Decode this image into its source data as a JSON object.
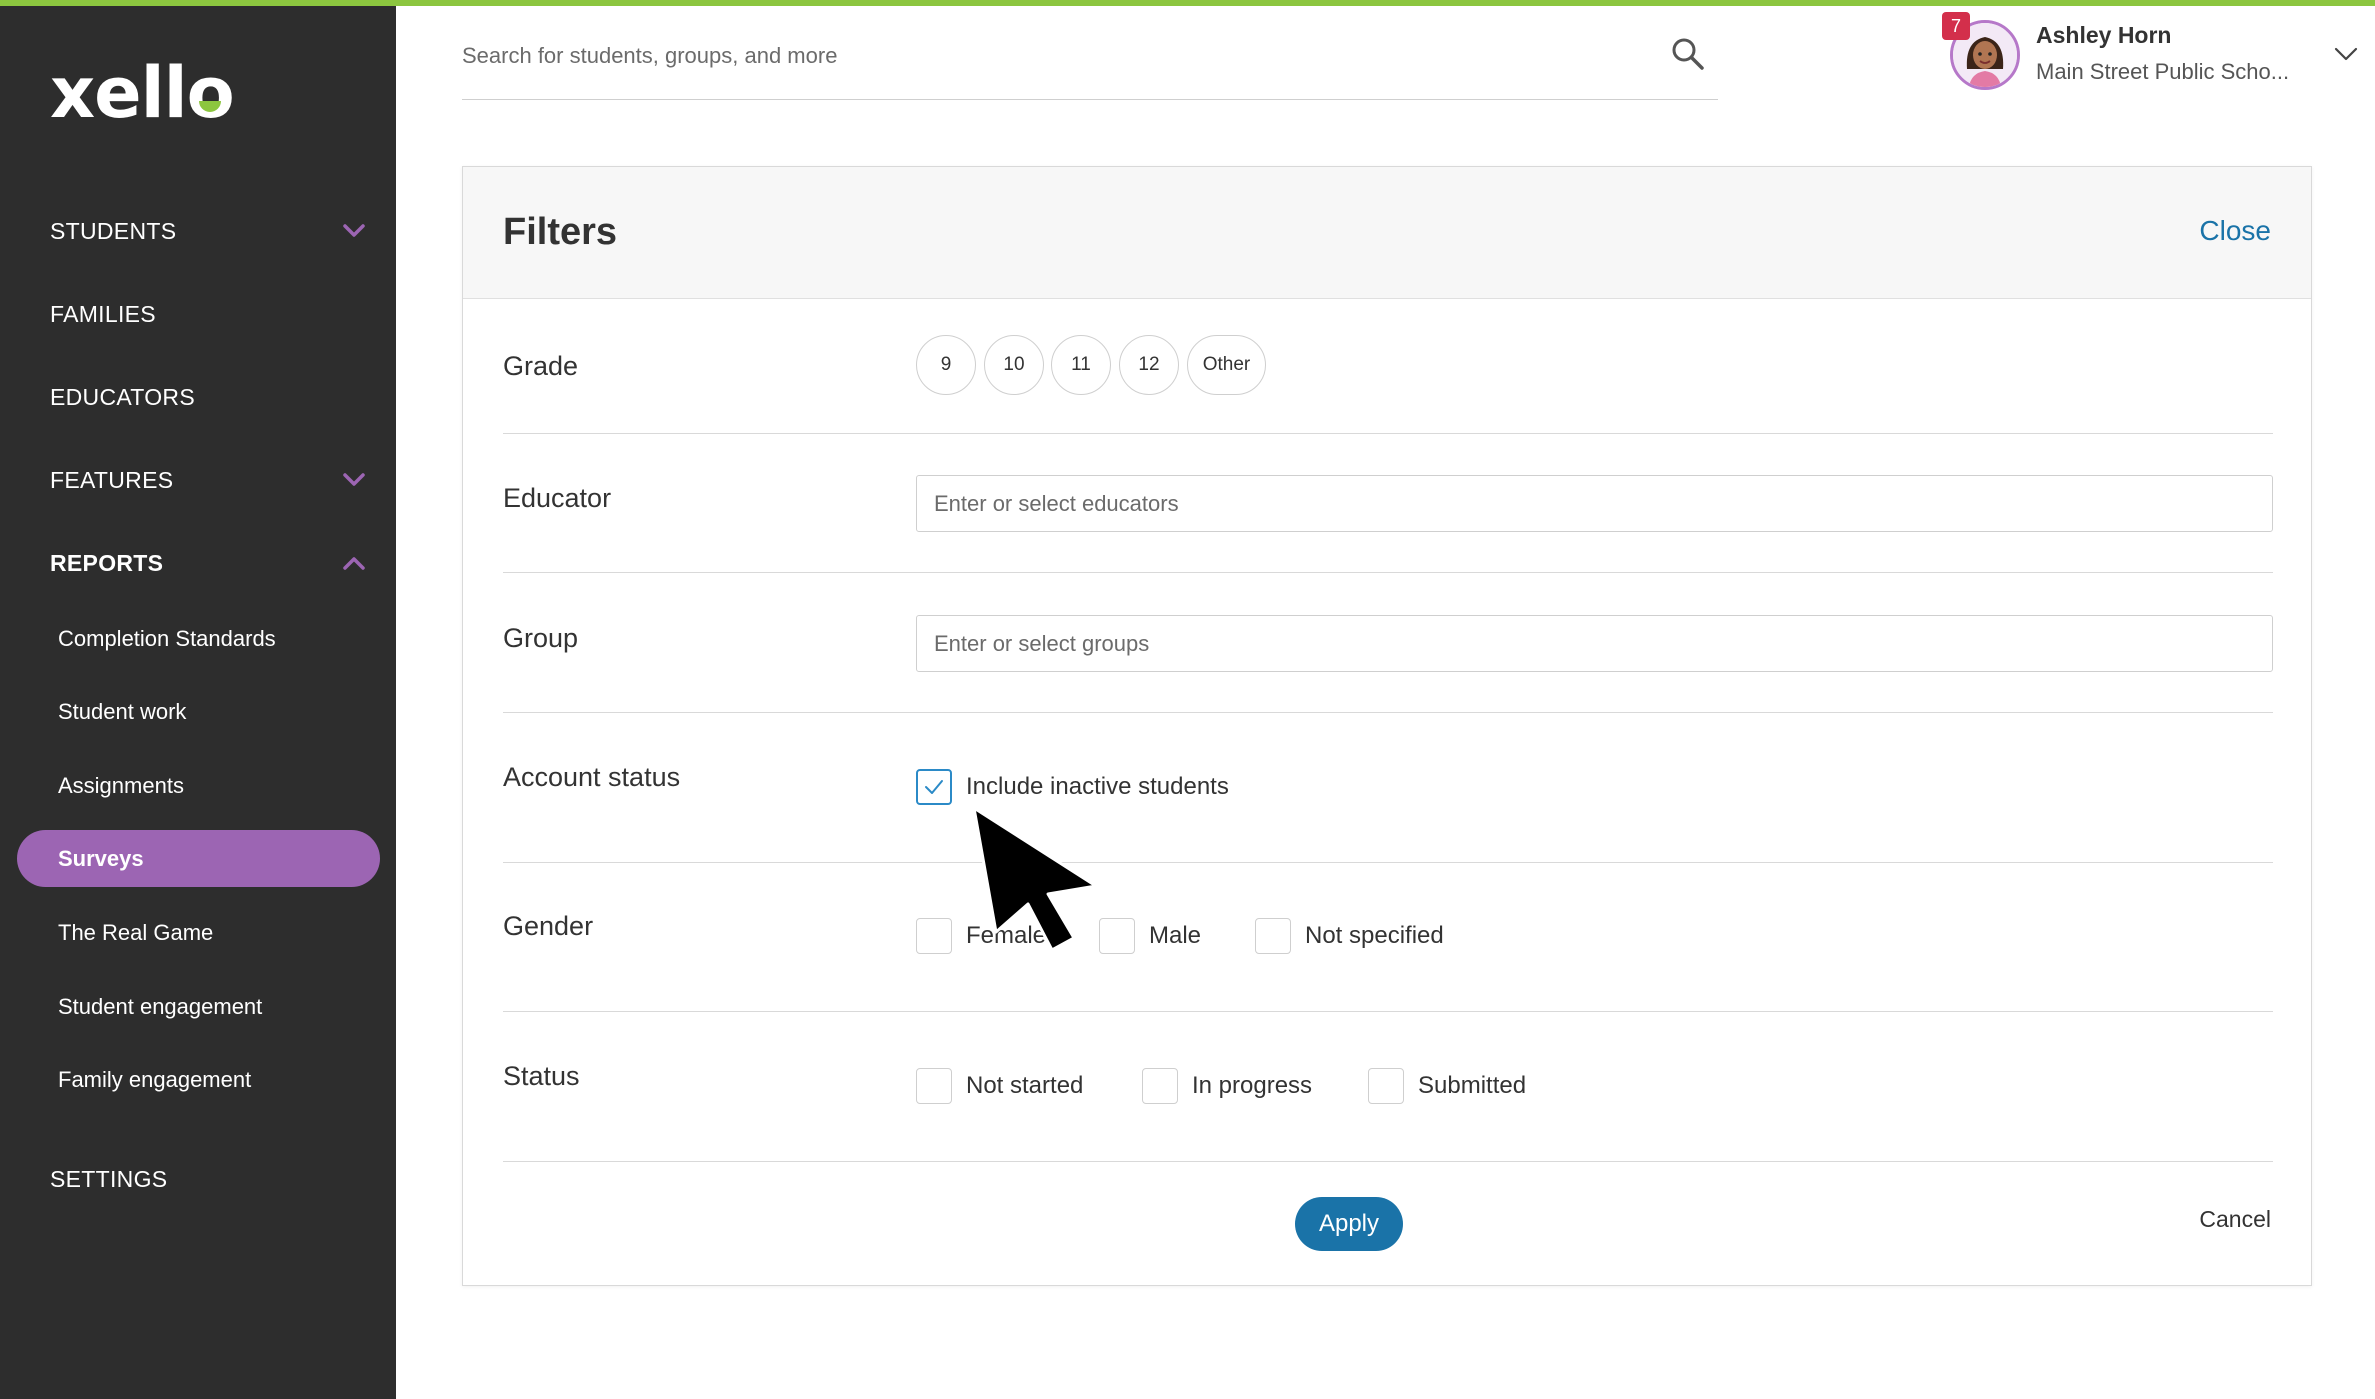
{
  "app": {
    "logo_text": "xello",
    "accent_color": "#8cc63f",
    "brand_purple": "#9c65b3",
    "link_blue": "#1a73a8"
  },
  "sidebar": {
    "nav": [
      {
        "label": "STUDENTS",
        "chevron": "down"
      },
      {
        "label": "FAMILIES"
      },
      {
        "label": "EDUCATORS"
      },
      {
        "label": "FEATURES",
        "chevron": "down"
      },
      {
        "label": "REPORTS",
        "chevron": "up",
        "expanded": true
      }
    ],
    "reports_items": [
      {
        "label": "Completion Standards"
      },
      {
        "label": "Student work"
      },
      {
        "label": "Assignments"
      },
      {
        "label": "Surveys",
        "active": true
      },
      {
        "label": "The Real Game"
      },
      {
        "label": "Student engagement"
      },
      {
        "label": "Family engagement"
      }
    ],
    "settings_label": "SETTINGS"
  },
  "header": {
    "search_placeholder": "Search for students, groups, and more",
    "search_icon": "search-icon",
    "profile": {
      "notification_count": "7",
      "name": "Ashley Horn",
      "school": "Main Street Public Scho..."
    }
  },
  "filters": {
    "title": "Filters",
    "close_label": "Close",
    "grade": {
      "label": "Grade",
      "options": [
        "9",
        "10",
        "11",
        "12",
        "Other"
      ]
    },
    "educator": {
      "label": "Educator",
      "placeholder": "Enter or select educators"
    },
    "group": {
      "label": "Group",
      "placeholder": "Enter or select groups"
    },
    "account_status": {
      "label": "Account status",
      "option": "Include inactive students",
      "checked": true
    },
    "gender": {
      "label": "Gender",
      "options": [
        "Female",
        "Male",
        "Not specified"
      ]
    },
    "status": {
      "label": "Status",
      "options": [
        "Not started",
        "In progress",
        "Submitted"
      ]
    },
    "apply_label": "Apply",
    "cancel_label": "Cancel"
  }
}
